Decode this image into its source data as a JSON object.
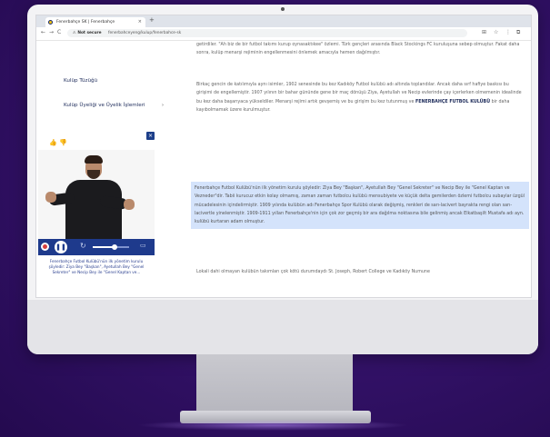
{
  "browser": {
    "tab_title": "Fenerbahçe SK | Fenerbahçe",
    "tab_close": "×",
    "new_tab": "+",
    "back": "←",
    "forward": "→",
    "reload": "C",
    "url_security": "⚠ Not secure",
    "url": "fenerbahceyeng/kulup/fenerbahce-sk"
  },
  "sidebar": {
    "items": [
      {
        "label": "Kulüp Tüzüğü"
      },
      {
        "label": "Kulüp Üyeliği ve Üyelik İşlemleri"
      }
    ],
    "thumbs": "👍 👎",
    "close_label": "×"
  },
  "video": {
    "caption": "Fenerbahçe Futbol Kulübü'nün ilk yönetim kurulu şöyledir: Ziya Bey \"Başkan\", Ayetullah Bey \"Genel Sekreter\" ve Necip Bey ile \"Genel Kaptan ve...",
    "progress": 0.6,
    "pause_glyph": "❚❚",
    "replay_glyph": "↻",
    "subtitle_glyph": "▭"
  },
  "content": {
    "p1": "getirdiler. \"Ah biz de bir futbol takımı kurup oynasaktıkee\" özlemi. Türk gençleri arasında Black Stockings FC kuruluşuna sebep olmuştur. Fakat daha sonra, kulüp menarşi rejiminin engellenmesini önlemek amacıyla hemen dağılmıştır.",
    "p2a": "Birkaç gencin de katılımıyla aynı isimler, 1902 senesinde bu kez Kadıköy Futbol kulübü adı altında toplandılar. Ancak daha sırf hafiye baskısı bu girişimi de engellemiştir. 1907 yılının bir bahar gününde gene bir maç dönüşü Ziya, Ayetullah ve Necip evlerinde çay içerlerken olmemenin idealinde bu kez daha başarıyaca yükseldiler. Menarşi rejimi artık gevşemiş ve bu girişim bu kez tutunmuş ve ",
    "p2b": "FENERBAHÇE FUTBOL KULÜBÜ",
    "p2c": " bir daha kayıbolmamak üzere kurulmuştur.",
    "p3": "Fenerbahçe Futbol Kulübü'nün ilk yönetim kurulu şöyledir: Ziya Bey \"Başkan\", Ayetullah Bey \"Genel Sekreter\" ve Necip Bey ile \"Genel Kaptan ve Vezneder\"dir. Tabii kurucuz etkin kolay olmamış, zaman zaman futbolcu kulübü mensubiyete ve küçük delta gemilerden özlemi futbolcu subaylar üzgül mücadelesinin içindelirmiştir. 1909 yılında kulübün adı Fenerbahçe Spor Kulübü olarak değişmiş, renkleri de sarı-lacivert bayrakta rengi olan sarı-lacivertle yinelenmiştir. 1909-1911 yılları Fenerbahçe'nin için çok zor geçmiş bir ara dağılma noktasına bile gelinmiş ancak Elkatbaşilt Mustafa adı ayn. kulübü kurtaran adam olmuştur.",
    "p4": "Lokali dahi olmayan kulübün takımları çok kötü durumdaydı St. Joseph, Robert College ve Kadıköy Numune"
  }
}
